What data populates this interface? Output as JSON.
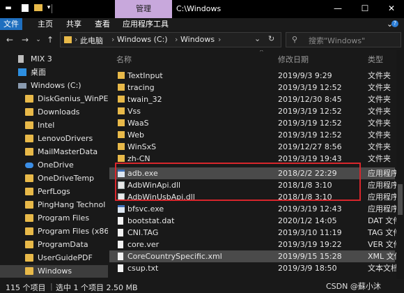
{
  "window": {
    "manage_tab": "管理",
    "title": "C:\\Windows",
    "minimize": "—",
    "maximize": "☐",
    "close": "✕"
  },
  "ribbon": {
    "tabs": [
      "文件",
      "主页",
      "共享",
      "查看",
      "应用程序工具"
    ],
    "expand_icon": "⌄",
    "help_icon": "?"
  },
  "nav": {
    "back": "←",
    "forward": "→",
    "recent": "⌄",
    "up": "↑",
    "breadcrumb": [
      "此电脑",
      "Windows (C:)",
      "Windows"
    ],
    "separator": "›",
    "history_dropdown": "⌄",
    "refresh": "↻",
    "search_placeholder": "搜索\"Windows\""
  },
  "sidebar": {
    "items": [
      {
        "label": "MIX 3",
        "icon": "phone-icon"
      },
      {
        "label": "桌面",
        "icon": "desktop-icon"
      },
      {
        "label": "Windows (C:)",
        "icon": "drive-icon"
      },
      {
        "label": "DiskGenius_WinPE",
        "icon": "folder-icon"
      },
      {
        "label": "Downloads",
        "icon": "folder-icon"
      },
      {
        "label": "Intel",
        "icon": "folder-icon"
      },
      {
        "label": "LenovoDrivers",
        "icon": "folder-icon"
      },
      {
        "label": "MailMasterData",
        "icon": "folder-icon"
      },
      {
        "label": "OneDrive",
        "icon": "cloud-icon"
      },
      {
        "label": "OneDriveTemp",
        "icon": "folder-icon"
      },
      {
        "label": "PerfLogs",
        "icon": "folder-icon"
      },
      {
        "label": "PingHang Technol",
        "icon": "folder-icon"
      },
      {
        "label": "Program Files",
        "icon": "folder-icon"
      },
      {
        "label": "Program Files (x86",
        "icon": "folder-icon"
      },
      {
        "label": "ProgramData",
        "icon": "folder-icon"
      },
      {
        "label": "UserGuidePDF",
        "icon": "folder-icon"
      },
      {
        "label": "Windows",
        "icon": "folder-icon",
        "selected": true
      }
    ]
  },
  "columns": {
    "name": "名称",
    "date": "修改日期",
    "type": "类型",
    "sort_icon": "^"
  },
  "files": [
    {
      "name": "TextInput",
      "date": "2019/9/3 9:29",
      "type": "文件夹",
      "icon": "folder-icon"
    },
    {
      "name": "tracing",
      "date": "2019/3/19 12:52",
      "type": "文件夹",
      "icon": "folder-icon"
    },
    {
      "name": "twain_32",
      "date": "2019/12/30 8:45",
      "type": "文件夹",
      "icon": "folder-icon"
    },
    {
      "name": "Vss",
      "date": "2019/3/19 12:52",
      "type": "文件夹",
      "icon": "folder-icon"
    },
    {
      "name": "WaaS",
      "date": "2019/3/19 12:52",
      "type": "文件夹",
      "icon": "folder-icon"
    },
    {
      "name": "Web",
      "date": "2019/3/19 12:52",
      "type": "文件夹",
      "icon": "folder-icon"
    },
    {
      "name": "WinSxS",
      "date": "2019/12/27 8:56",
      "type": "文件夹",
      "icon": "folder-icon"
    },
    {
      "name": "zh-CN",
      "date": "2019/3/19 19:43",
      "type": "文件夹",
      "icon": "folder-icon"
    },
    {
      "name": "adb.exe",
      "date": "2018/2/2 22:29",
      "type": "应用程序",
      "icon": "exe-icon",
      "selected": true
    },
    {
      "name": "AdbWinApi.dll",
      "date": "2018/1/8 3:10",
      "type": "应用程序",
      "icon": "dll-icon"
    },
    {
      "name": "AdbWinUsbApi.dll",
      "date": "2018/1/8 3:10",
      "type": "应用程序",
      "icon": "dll-icon"
    },
    {
      "name": "bfsvc.exe",
      "date": "2019/3/19 12:43",
      "type": "应用程序",
      "icon": "exe-icon"
    },
    {
      "name": "bootstat.dat",
      "date": "2020/1/2 14:05",
      "type": "DAT 文件",
      "icon": "file-icon"
    },
    {
      "name": "CNI.TAG",
      "date": "2019/3/10 11:19",
      "type": "TAG 文件",
      "icon": "file-icon"
    },
    {
      "name": "core.ver",
      "date": "2019/3/19 19:22",
      "type": "VER 文件",
      "icon": "file-icon"
    },
    {
      "name": "CoreCountrySpecific.xml",
      "date": "2019/9/15 15:28",
      "type": "XML 文件",
      "icon": "file-icon",
      "highlight": true
    },
    {
      "name": "csup.txt",
      "date": "2019/3/9 18:50",
      "type": "文本文档",
      "icon": "file-icon"
    }
  ],
  "status": {
    "count": "115 个项目",
    "selection": "选中 1 个项目  2.50 MB"
  },
  "watermark": "CSDN @蘇小沐"
}
